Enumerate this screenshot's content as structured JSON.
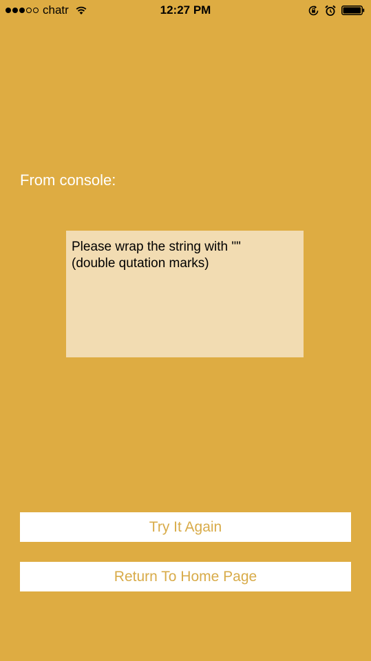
{
  "status_bar": {
    "signal_filled": 3,
    "signal_total": 5,
    "carrier": "chatr",
    "time": "12:27 PM",
    "icons": [
      "wifi-icon",
      "rotation-lock-icon",
      "alarm-icon",
      "battery-icon"
    ],
    "battery_level": 0.95
  },
  "main": {
    "console_label": "From console:",
    "console_message": "Please wrap the string with \"\" (double qutation marks)"
  },
  "buttons": {
    "try_again": "Try It Again",
    "return_home": "Return To Home Page"
  },
  "colors": {
    "background": "#deac42",
    "console_box": "#f2dcb2",
    "button_text": "#d8ab49",
    "button_background": "#ffffff"
  }
}
